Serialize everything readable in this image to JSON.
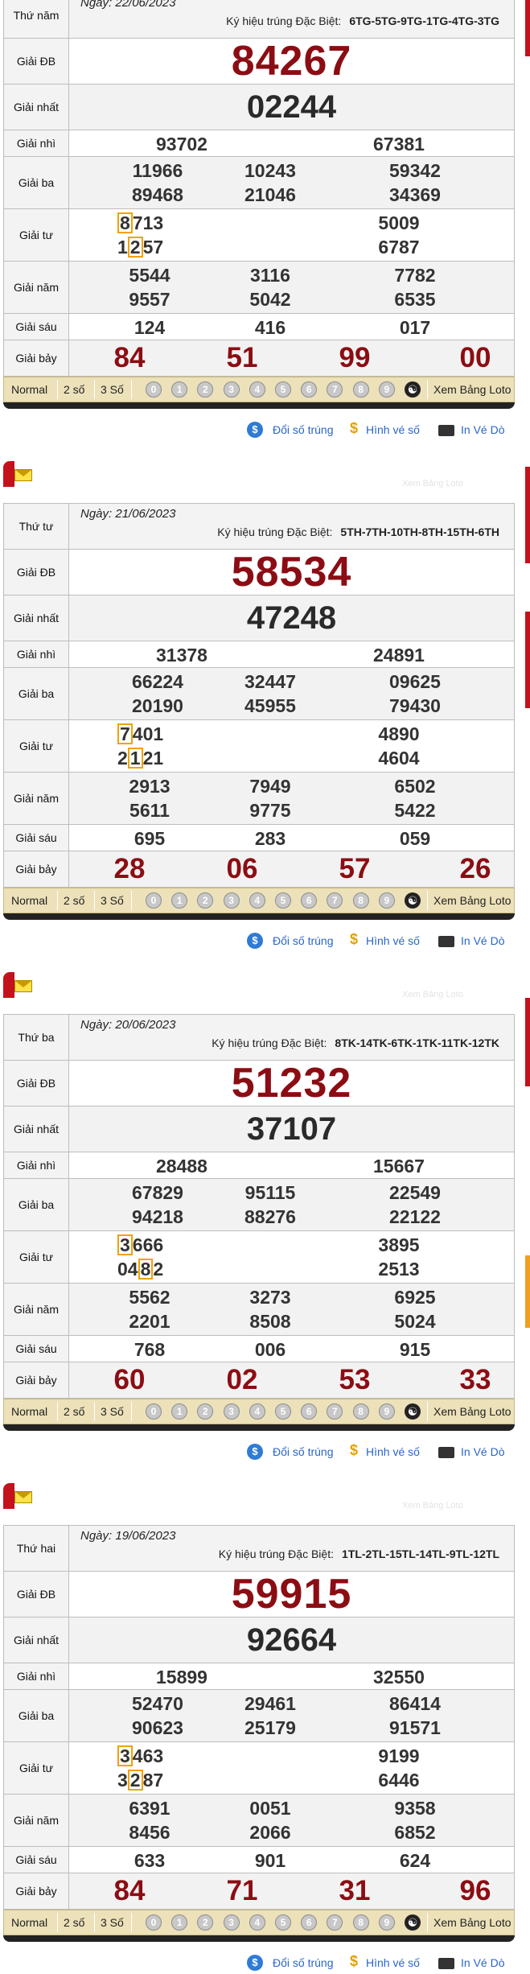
{
  "labels": {
    "special": "Giải ĐB",
    "first": "Giải nhất",
    "second": "Giải nhì",
    "third": "Giải ba",
    "fourth": "Giải tư",
    "fifth": "Giải năm",
    "sixth": "Giải sáu",
    "seventh": "Giải bảy",
    "kyhieu_prefix": "Ký hiệu trúng Đặc Biệt:"
  },
  "bar": {
    "normal": "Normal",
    "two": "2 số",
    "three": "3 Số",
    "digits": [
      "0",
      "1",
      "2",
      "3",
      "4",
      "5",
      "6",
      "7",
      "8",
      "9"
    ],
    "loto": "Xem Bảng Loto"
  },
  "links": {
    "doi": "Đổi số trúng",
    "hinh": "Hình vé số",
    "in": "In Vé Dò"
  },
  "faint_header": "Xem Bảng Loto",
  "colors": {
    "special": "#8b0d13",
    "highlight": "#f2a100",
    "bar": "#ece1b9",
    "link": "#2a65c8"
  },
  "draws": [
    {
      "weekday": "Thứ năm",
      "date": "Ngày: 22/06/2023",
      "code": "6TG-5TG-9TG-1TG-4TG-3TG",
      "special": "84267",
      "first": "02244",
      "second": [
        "93702",
        "67381"
      ],
      "third": [
        "11966",
        "10243",
        "59342",
        "89468",
        "21046",
        "34369"
      ],
      "fourth_hl": [
        [
          "8",
          "713"
        ],
        [
          "1",
          "2",
          "57"
        ]
      ],
      "fourth": [
        "5009",
        "6787"
      ],
      "fifth": [
        "5544",
        "3116",
        "7782",
        "9557",
        "5042",
        "6535"
      ],
      "sixth": [
        "124",
        "416",
        "017"
      ],
      "seventh": [
        "84",
        "51",
        "99",
        "00"
      ]
    },
    {
      "weekday": "Thứ tư",
      "date": "Ngày: 21/06/2023",
      "code": "5TH-7TH-10TH-8TH-15TH-6TH",
      "special": "58534",
      "first": "47248",
      "second": [
        "31378",
        "24891"
      ],
      "third": [
        "66224",
        "32447",
        "09625",
        "20190",
        "45955",
        "79430"
      ],
      "fourth_hl": [
        [
          "7",
          "401"
        ],
        [
          "2",
          "1",
          "21"
        ]
      ],
      "fourth": [
        "4890",
        "4604"
      ],
      "fifth": [
        "2913",
        "7949",
        "6502",
        "5611",
        "9775",
        "5422"
      ],
      "sixth": [
        "695",
        "283",
        "059"
      ],
      "seventh": [
        "28",
        "06",
        "57",
        "26"
      ]
    },
    {
      "weekday": "Thứ ba",
      "date": "Ngày: 20/06/2023",
      "code": "8TK-14TK-6TK-1TK-11TK-12TK",
      "special": "51232",
      "first": "37107",
      "second": [
        "28488",
        "15667"
      ],
      "third": [
        "67829",
        "95115",
        "22549",
        "94218",
        "88276",
        "22122"
      ],
      "fourth_hl": [
        [
          "3",
          "666"
        ],
        [
          "04",
          "8",
          "2"
        ]
      ],
      "fourth": [
        "3895",
        "2513"
      ],
      "fifth": [
        "5562",
        "3273",
        "6925",
        "2201",
        "8508",
        "5024"
      ],
      "sixth": [
        "768",
        "006",
        "915"
      ],
      "seventh": [
        "60",
        "02",
        "53",
        "33"
      ]
    },
    {
      "weekday": "Thứ hai",
      "date": "Ngày: 19/06/2023",
      "code": "1TL-2TL-15TL-14TL-9TL-12TL",
      "special": "59915",
      "first": "92664",
      "second": [
        "15899",
        "32550"
      ],
      "third": [
        "52470",
        "29461",
        "86414",
        "90623",
        "25179",
        "91571"
      ],
      "fourth_hl": [
        [
          "3",
          "463"
        ],
        [
          "3",
          "2",
          "87"
        ]
      ],
      "fourth": [
        "9199",
        "6446"
      ],
      "fifth": [
        "6391",
        "0051",
        "9358",
        "8456",
        "2066",
        "6852"
      ],
      "sixth": [
        "633",
        "901",
        "624"
      ],
      "seventh": [
        "84",
        "71",
        "31",
        "96"
      ]
    }
  ]
}
